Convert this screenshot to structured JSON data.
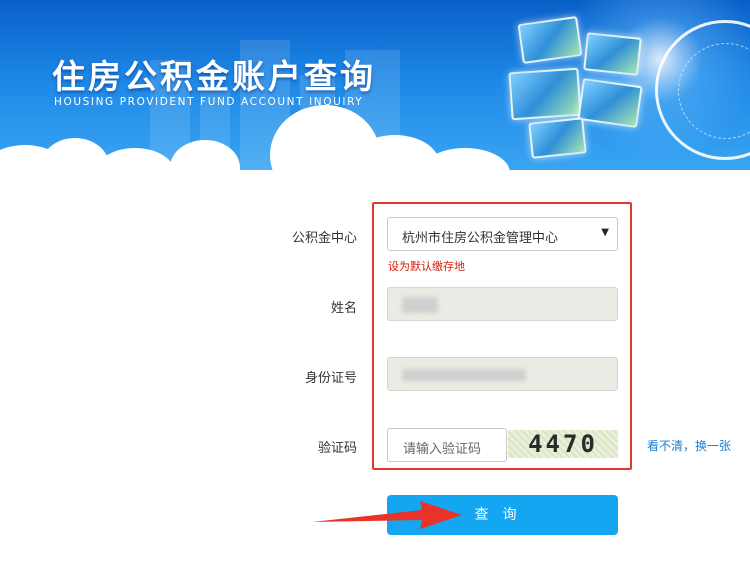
{
  "banner": {
    "title": "住房公积金账户查询",
    "subtitle": "HOUSING PROVIDENT FUND  ACCOUNT INQUIRY"
  },
  "form": {
    "fund_center": {
      "label": "公积金中心",
      "selected": "杭州市住房公积金管理中心",
      "hint": "设为默认缴存地"
    },
    "name": {
      "label": "姓名"
    },
    "id_number": {
      "label": "身份证号"
    },
    "captcha": {
      "label": "验证码",
      "placeholder": "请输入验证码",
      "image_text": "4470",
      "refresh_link": "看不清，换一张"
    },
    "submit_label": "查询"
  },
  "colors": {
    "accent": "#14a6f0",
    "highlight_box": "#e23a2a",
    "hint_text": "#d81e06",
    "link": "#1a7fd0"
  }
}
